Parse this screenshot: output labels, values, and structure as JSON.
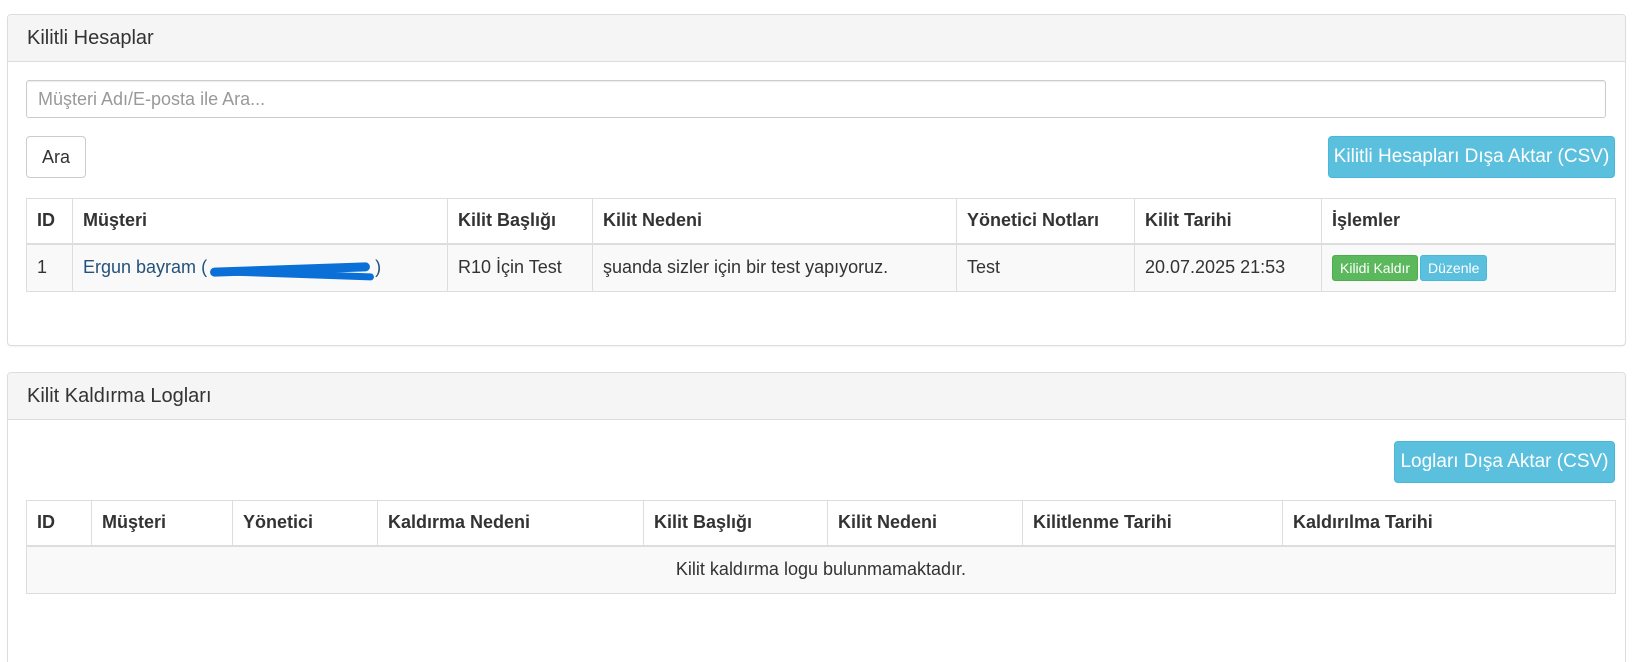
{
  "locked_panel": {
    "title": "Kilitli Hesaplar",
    "search_placeholder": "Müşteri Adı/E-posta ile Ara...",
    "search_button": "Ara",
    "export_button": "Kilitli Hesapları Dışa Aktar (CSV)",
    "columns": [
      "ID",
      "Müşteri",
      "Kilit Başlığı",
      "Kilit Nedeni",
      "Yönetici Notları",
      "Kilit Tarihi",
      "İşlemler"
    ],
    "rows": [
      {
        "id": "1",
        "customer_name": "Ergun bayram",
        "customer_open": "(",
        "customer_close": ")",
        "lock_title": "R10 İçin Test",
        "lock_reason": "şuanda sizler için bir test yapıyoruz.",
        "admin_notes": "Test",
        "lock_date": "20.07.2025 21:53",
        "unlock_label": "Kilidi Kaldır",
        "edit_label": "Düzenle"
      }
    ]
  },
  "logs_panel": {
    "title": "Kilit Kaldırma Logları",
    "export_button": "Logları Dışa Aktar (CSV)",
    "columns": [
      "ID",
      "Müşteri",
      "Yönetici",
      "Kaldırma Nedeni",
      "Kilit Başlığı",
      "Kilit Nedeni",
      "Kilitlenme Tarihi",
      "Kaldırılma Tarihi"
    ],
    "empty_message": "Kilit kaldırma logu bulunmamaktadır."
  },
  "colors": {
    "info": "#5bc0de",
    "success": "#5cb85c",
    "link": "#23527c",
    "redaction": "#0a6fd6"
  }
}
